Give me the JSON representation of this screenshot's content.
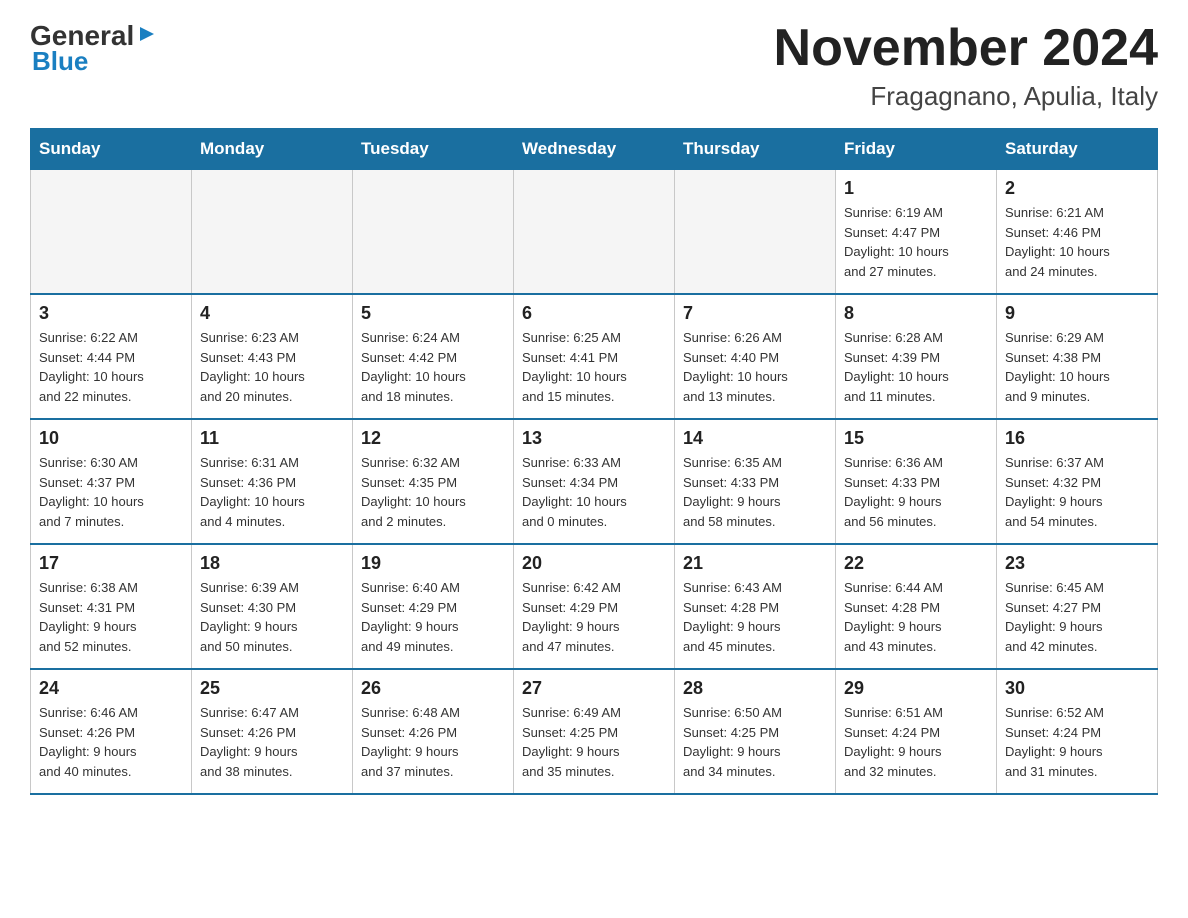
{
  "header": {
    "logo_general": "General",
    "logo_blue": "Blue",
    "title": "November 2024",
    "subtitle": "Fragagnano, Apulia, Italy"
  },
  "weekdays": [
    "Sunday",
    "Monday",
    "Tuesday",
    "Wednesday",
    "Thursday",
    "Friday",
    "Saturday"
  ],
  "weeks": [
    [
      {
        "day": "",
        "info": ""
      },
      {
        "day": "",
        "info": ""
      },
      {
        "day": "",
        "info": ""
      },
      {
        "day": "",
        "info": ""
      },
      {
        "day": "",
        "info": ""
      },
      {
        "day": "1",
        "info": "Sunrise: 6:19 AM\nSunset: 4:47 PM\nDaylight: 10 hours\nand 27 minutes."
      },
      {
        "day": "2",
        "info": "Sunrise: 6:21 AM\nSunset: 4:46 PM\nDaylight: 10 hours\nand 24 minutes."
      }
    ],
    [
      {
        "day": "3",
        "info": "Sunrise: 6:22 AM\nSunset: 4:44 PM\nDaylight: 10 hours\nand 22 minutes."
      },
      {
        "day": "4",
        "info": "Sunrise: 6:23 AM\nSunset: 4:43 PM\nDaylight: 10 hours\nand 20 minutes."
      },
      {
        "day": "5",
        "info": "Sunrise: 6:24 AM\nSunset: 4:42 PM\nDaylight: 10 hours\nand 18 minutes."
      },
      {
        "day": "6",
        "info": "Sunrise: 6:25 AM\nSunset: 4:41 PM\nDaylight: 10 hours\nand 15 minutes."
      },
      {
        "day": "7",
        "info": "Sunrise: 6:26 AM\nSunset: 4:40 PM\nDaylight: 10 hours\nand 13 minutes."
      },
      {
        "day": "8",
        "info": "Sunrise: 6:28 AM\nSunset: 4:39 PM\nDaylight: 10 hours\nand 11 minutes."
      },
      {
        "day": "9",
        "info": "Sunrise: 6:29 AM\nSunset: 4:38 PM\nDaylight: 10 hours\nand 9 minutes."
      }
    ],
    [
      {
        "day": "10",
        "info": "Sunrise: 6:30 AM\nSunset: 4:37 PM\nDaylight: 10 hours\nand 7 minutes."
      },
      {
        "day": "11",
        "info": "Sunrise: 6:31 AM\nSunset: 4:36 PM\nDaylight: 10 hours\nand 4 minutes."
      },
      {
        "day": "12",
        "info": "Sunrise: 6:32 AM\nSunset: 4:35 PM\nDaylight: 10 hours\nand 2 minutes."
      },
      {
        "day": "13",
        "info": "Sunrise: 6:33 AM\nSunset: 4:34 PM\nDaylight: 10 hours\nand 0 minutes."
      },
      {
        "day": "14",
        "info": "Sunrise: 6:35 AM\nSunset: 4:33 PM\nDaylight: 9 hours\nand 58 minutes."
      },
      {
        "day": "15",
        "info": "Sunrise: 6:36 AM\nSunset: 4:33 PM\nDaylight: 9 hours\nand 56 minutes."
      },
      {
        "day": "16",
        "info": "Sunrise: 6:37 AM\nSunset: 4:32 PM\nDaylight: 9 hours\nand 54 minutes."
      }
    ],
    [
      {
        "day": "17",
        "info": "Sunrise: 6:38 AM\nSunset: 4:31 PM\nDaylight: 9 hours\nand 52 minutes."
      },
      {
        "day": "18",
        "info": "Sunrise: 6:39 AM\nSunset: 4:30 PM\nDaylight: 9 hours\nand 50 minutes."
      },
      {
        "day": "19",
        "info": "Sunrise: 6:40 AM\nSunset: 4:29 PM\nDaylight: 9 hours\nand 49 minutes."
      },
      {
        "day": "20",
        "info": "Sunrise: 6:42 AM\nSunset: 4:29 PM\nDaylight: 9 hours\nand 47 minutes."
      },
      {
        "day": "21",
        "info": "Sunrise: 6:43 AM\nSunset: 4:28 PM\nDaylight: 9 hours\nand 45 minutes."
      },
      {
        "day": "22",
        "info": "Sunrise: 6:44 AM\nSunset: 4:28 PM\nDaylight: 9 hours\nand 43 minutes."
      },
      {
        "day": "23",
        "info": "Sunrise: 6:45 AM\nSunset: 4:27 PM\nDaylight: 9 hours\nand 42 minutes."
      }
    ],
    [
      {
        "day": "24",
        "info": "Sunrise: 6:46 AM\nSunset: 4:26 PM\nDaylight: 9 hours\nand 40 minutes."
      },
      {
        "day": "25",
        "info": "Sunrise: 6:47 AM\nSunset: 4:26 PM\nDaylight: 9 hours\nand 38 minutes."
      },
      {
        "day": "26",
        "info": "Sunrise: 6:48 AM\nSunset: 4:26 PM\nDaylight: 9 hours\nand 37 minutes."
      },
      {
        "day": "27",
        "info": "Sunrise: 6:49 AM\nSunset: 4:25 PM\nDaylight: 9 hours\nand 35 minutes."
      },
      {
        "day": "28",
        "info": "Sunrise: 6:50 AM\nSunset: 4:25 PM\nDaylight: 9 hours\nand 34 minutes."
      },
      {
        "day": "29",
        "info": "Sunrise: 6:51 AM\nSunset: 4:24 PM\nDaylight: 9 hours\nand 32 minutes."
      },
      {
        "day": "30",
        "info": "Sunrise: 6:52 AM\nSunset: 4:24 PM\nDaylight: 9 hours\nand 31 minutes."
      }
    ]
  ]
}
